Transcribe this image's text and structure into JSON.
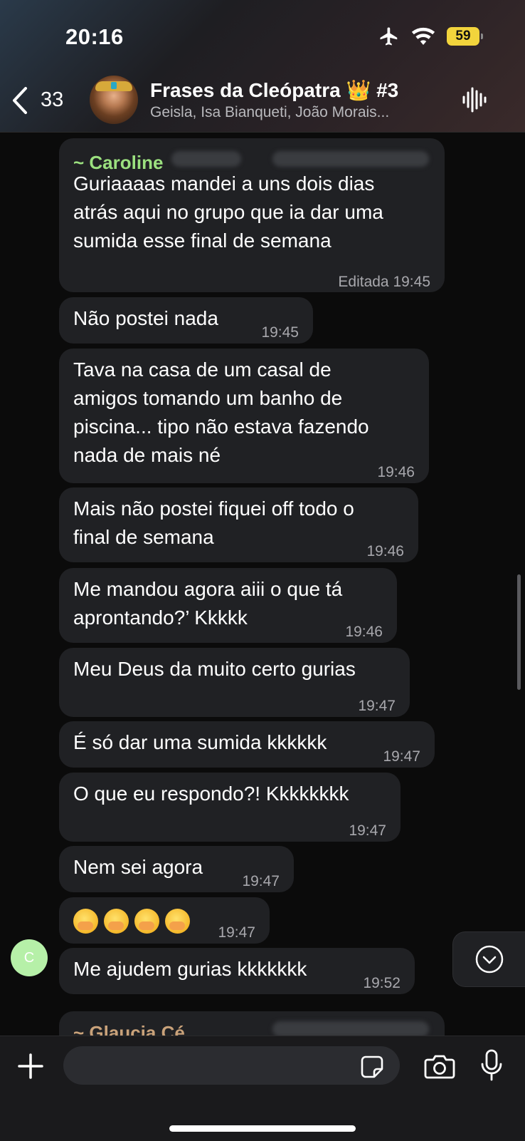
{
  "status_bar": {
    "time": "20:16",
    "battery": "59"
  },
  "header": {
    "back_count": "33",
    "title": "Frases da Cleópatra 👑 #3",
    "subtitle": "Geisla, Isa Bianqueti, João Morais..."
  },
  "messages": [
    {
      "sender": "~ Caroline",
      "text": "Guriaaaas mandei a uns dois dias\natrás aqui no grupo que ia dar uma\nsumida esse final de semana",
      "meta": "Editada 19:45"
    },
    {
      "text": "Não postei nada",
      "meta": "19:45"
    },
    {
      "text": "Tava na casa de um casal de\namigos tomando um banho de\npiscina... tipo não estava fazendo\nnada de mais né",
      "meta": "19:46"
    },
    {
      "text": "Mais não postei fiquei off todo o\nfinal de semana",
      "meta": "19:46"
    },
    {
      "text": "Me mandou agora aiii o que tá\naprontando?’ Kkkkk",
      "meta": "19:46"
    },
    {
      "text": "Meu Deus da muito certo gurias",
      "meta": "19:47"
    },
    {
      "text": "É só dar uma sumida kkkkkk",
      "meta": "19:47"
    },
    {
      "text": "O que eu respondo?! Kkkkkkkk",
      "meta": "19:47"
    },
    {
      "text": "Nem sei agora",
      "meta": "19:47"
    },
    {
      "emojis": [
        "😱",
        "🤭",
        "🤭",
        "🤭"
      ],
      "meta": "19:47"
    },
    {
      "avatar_letter": "C",
      "text": "Me ajudem gurias kkkkkkk",
      "meta": "19:52"
    },
    {
      "sender": "~ Glaucia Cé"
    }
  ],
  "composer": {
    "placeholder": ""
  },
  "colors": {
    "sender_caroline": "#9be07f",
    "sender_glaucia": "#c9a27a",
    "bubble": "#202124",
    "battery": "#f2d43c"
  }
}
